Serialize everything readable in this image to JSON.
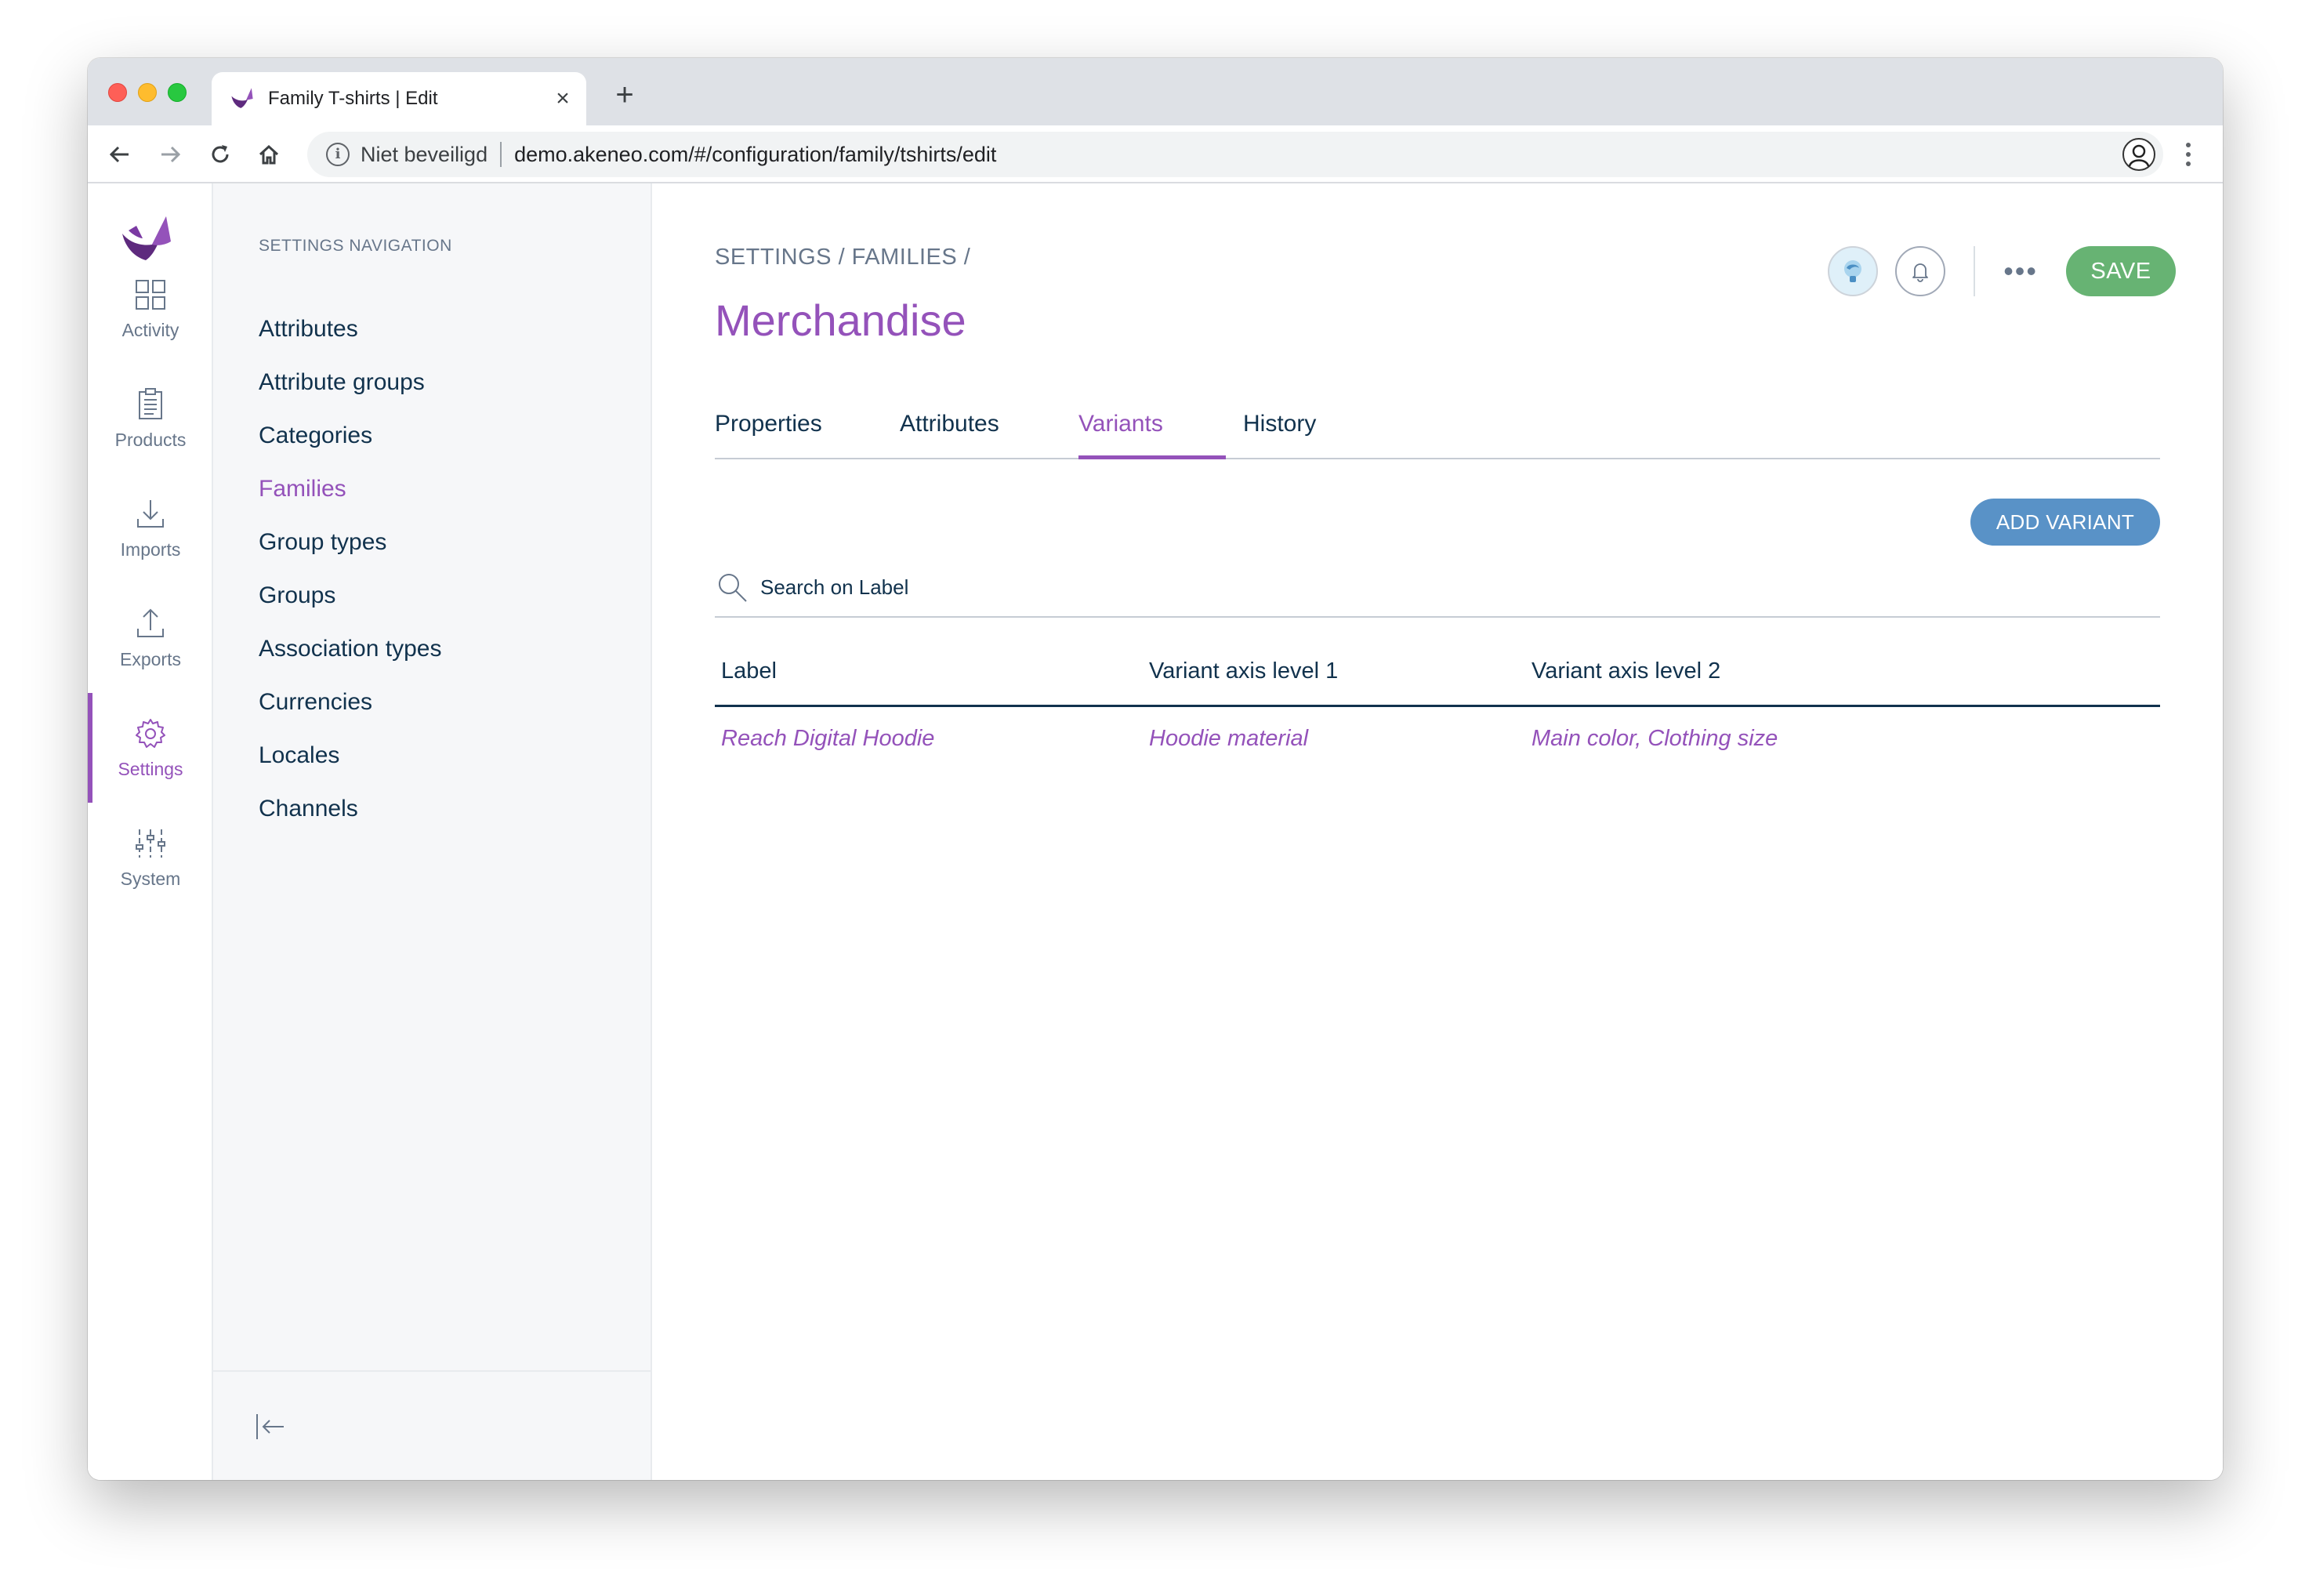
{
  "browser": {
    "tab_title": "Family T-shirts | Edit",
    "close_glyph": "×",
    "new_tab_glyph": "+",
    "security_label": "Niet beveiligd",
    "url": "demo.akeneo.com/#/configuration/family/tshirts/edit",
    "star_glyph": "☆"
  },
  "rail": {
    "items": [
      {
        "label": "Activity",
        "icon": "grid-icon"
      },
      {
        "label": "Products",
        "icon": "clipboard-icon"
      },
      {
        "label": "Imports",
        "icon": "download-icon"
      },
      {
        "label": "Exports",
        "icon": "upload-icon"
      },
      {
        "label": "Settings",
        "icon": "gear-icon",
        "active": true
      },
      {
        "label": "System",
        "icon": "sliders-icon"
      }
    ]
  },
  "subnav": {
    "title": "SETTINGS NAVIGATION",
    "items": [
      {
        "label": "Attributes"
      },
      {
        "label": "Attribute groups"
      },
      {
        "label": "Categories"
      },
      {
        "label": "Families",
        "active": true
      },
      {
        "label": "Group types"
      },
      {
        "label": "Groups"
      },
      {
        "label": "Association types"
      },
      {
        "label": "Currencies"
      },
      {
        "label": "Locales"
      },
      {
        "label": "Channels"
      }
    ]
  },
  "header": {
    "breadcrumb": "SETTINGS / FAMILIES /",
    "title": "Merchandise",
    "more_glyph": "•••",
    "save_label": "SAVE"
  },
  "tabs": [
    {
      "label": "Properties"
    },
    {
      "label": "Attributes"
    },
    {
      "label": "Variants",
      "active": true
    },
    {
      "label": "History"
    }
  ],
  "variants": {
    "add_label": "ADD VARIANT",
    "search_placeholder": "Search on Label",
    "columns": [
      "Label",
      "Variant axis level 1",
      "Variant axis level 2"
    ],
    "rows": [
      [
        "Reach Digital Hoodie",
        "Hoodie material",
        "Main color, Clothing size"
      ]
    ]
  },
  "colors": {
    "brand_purple": "#9452ba",
    "save_green": "#67b373",
    "add_blue": "#5992c7",
    "text_dark": "#11324d"
  }
}
